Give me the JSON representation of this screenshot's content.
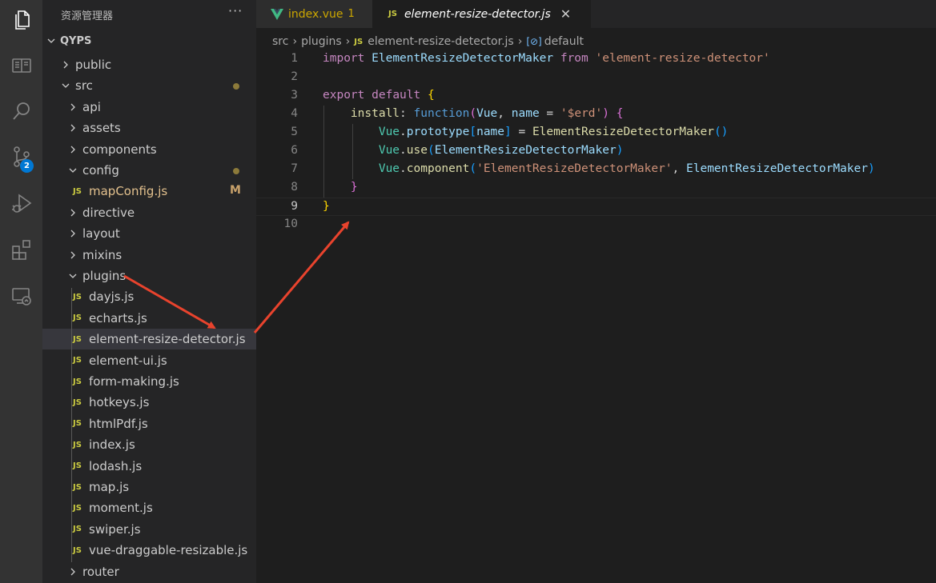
{
  "sidebar": {
    "title": "资源管理器",
    "more": "···",
    "root": "QYPS",
    "items": [
      {
        "label": "public",
        "type": "folder",
        "open": false,
        "depth": 1
      },
      {
        "label": "src",
        "type": "folder",
        "open": true,
        "depth": 1,
        "modified": true
      },
      {
        "label": "api",
        "type": "folder",
        "open": false,
        "depth": 2
      },
      {
        "label": "assets",
        "type": "folder",
        "open": false,
        "depth": 2
      },
      {
        "label": "components",
        "type": "folder",
        "open": false,
        "depth": 2
      },
      {
        "label": "config",
        "type": "folder",
        "open": true,
        "depth": 2,
        "modified": true
      },
      {
        "label": "mapConfig.js",
        "type": "file",
        "depth": 3,
        "status": "M"
      },
      {
        "label": "directive",
        "type": "folder",
        "open": false,
        "depth": 2
      },
      {
        "label": "layout",
        "type": "folder",
        "open": false,
        "depth": 2
      },
      {
        "label": "mixins",
        "type": "folder",
        "open": false,
        "depth": 2
      },
      {
        "label": "plugins",
        "type": "folder",
        "open": true,
        "depth": 2
      },
      {
        "label": "dayjs.js",
        "type": "file",
        "depth": 3
      },
      {
        "label": "echarts.js",
        "type": "file",
        "depth": 3
      },
      {
        "label": "element-resize-detector.js",
        "type": "file",
        "depth": 3,
        "selected": true
      },
      {
        "label": "element-ui.js",
        "type": "file",
        "depth": 3
      },
      {
        "label": "form-making.js",
        "type": "file",
        "depth": 3
      },
      {
        "label": "hotkeys.js",
        "type": "file",
        "depth": 3
      },
      {
        "label": "htmlPdf.js",
        "type": "file",
        "depth": 3
      },
      {
        "label": "index.js",
        "type": "file",
        "depth": 3
      },
      {
        "label": "lodash.js",
        "type": "file",
        "depth": 3
      },
      {
        "label": "map.js",
        "type": "file",
        "depth": 3
      },
      {
        "label": "moment.js",
        "type": "file",
        "depth": 3
      },
      {
        "label": "swiper.js",
        "type": "file",
        "depth": 3
      },
      {
        "label": "vue-draggable-resizable.js",
        "type": "file",
        "depth": 3
      },
      {
        "label": "router",
        "type": "folder",
        "open": false,
        "depth": 2
      }
    ],
    "file_icon_text": "JS"
  },
  "activity": {
    "source_control_badge": "2",
    "icons": [
      "files-icon",
      "book-icon",
      "search-icon",
      "source-control-icon",
      "run-debug-icon",
      "extensions-icon",
      "remote-explorer-icon"
    ]
  },
  "tabs": [
    {
      "label": "index.vue",
      "count": "1",
      "active": false
    },
    {
      "label": "element-resize-detector.js",
      "icon": "JS",
      "active": true,
      "close": "✕"
    }
  ],
  "breadcrumb": {
    "parts": [
      "src",
      "plugins",
      "element-resize-detector.js",
      "default"
    ],
    "js_icon": "JS",
    "symbol_icon": "[⊘]"
  },
  "editor": {
    "current_line": 9,
    "line_numbers": [
      "1",
      "2",
      "3",
      "4",
      "5",
      "6",
      "7",
      "8",
      "9",
      "10"
    ]
  },
  "colors": {
    "activity_bg": "#333333",
    "sidebar_bg": "#252526",
    "editor_bg": "#1e1e1e",
    "selection_bg": "#37373d",
    "annotation_arrow": "#e8432d"
  }
}
